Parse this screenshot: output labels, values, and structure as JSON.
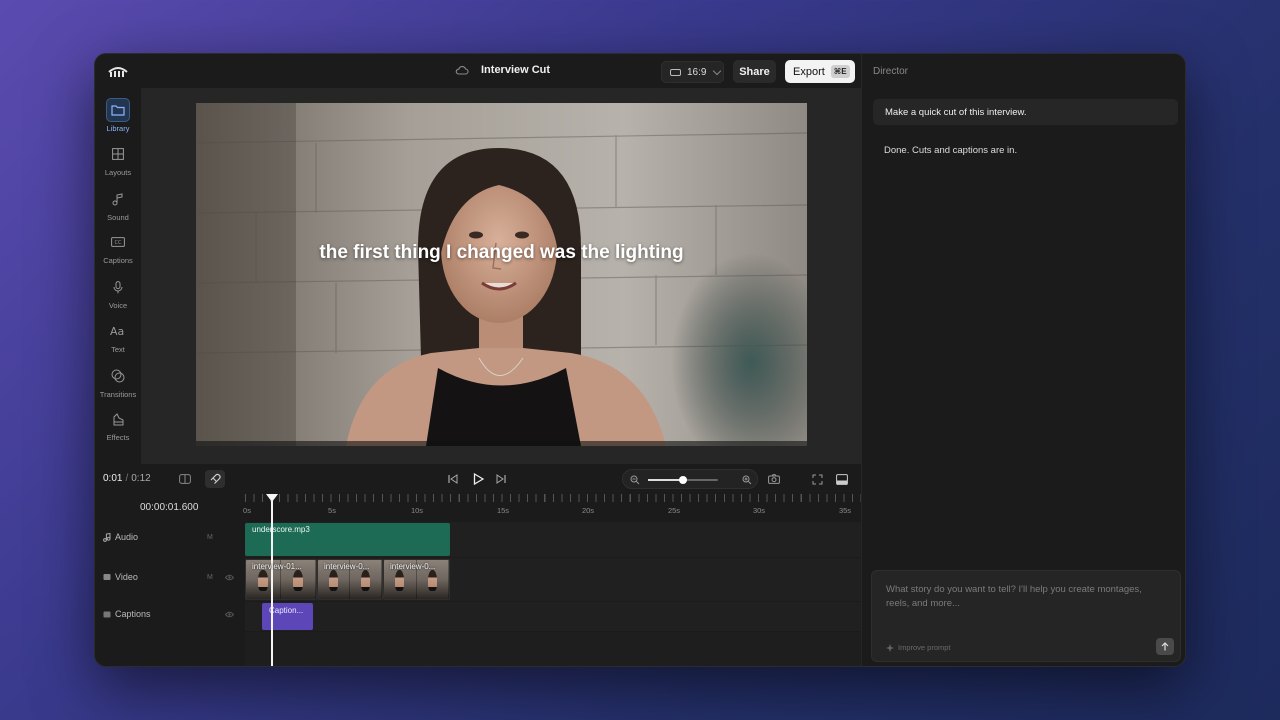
{
  "app": {
    "project_title": "Interview Cut",
    "aspect_ratio": "16:9",
    "share_label": "Share",
    "export_label": "Export",
    "export_shortcut": "⌘E"
  },
  "sidebar": {
    "items": [
      {
        "label": "Library",
        "icon": "folder-icon",
        "active": true
      },
      {
        "label": "Layouts",
        "icon": "grid-icon"
      },
      {
        "label": "Sound",
        "icon": "music-note-icon"
      },
      {
        "label": "Captions",
        "icon": "cc-icon"
      },
      {
        "label": "Voice",
        "icon": "microphone-icon"
      },
      {
        "label": "Text",
        "icon": "text-aa-icon"
      },
      {
        "label": "Transitions",
        "icon": "overlap-circles-icon"
      },
      {
        "label": "Effects",
        "icon": "effects-icon"
      }
    ]
  },
  "preview": {
    "caption": "the first thing I changed was the lighting"
  },
  "transport": {
    "current_time": "0:01",
    "total_time": "0:12",
    "zoom_level": 0.5
  },
  "timeline": {
    "timecode": "00:00:01.600",
    "ruler_labels": [
      "0s",
      "5s",
      "10s",
      "15s",
      "20s",
      "25s",
      "30s",
      "35s"
    ],
    "tracks": [
      {
        "name": "Audio",
        "icon": "music-note-icon",
        "mute": "M"
      },
      {
        "name": "Video",
        "icon": "video-icon",
        "mute": "M"
      },
      {
        "name": "Captions",
        "icon": "captions-icon"
      }
    ],
    "clips": {
      "audio": "underscore.mp3",
      "video": [
        "interview-01...",
        "interview-0...",
        "interview-0..."
      ],
      "caption": "Caption..."
    }
  },
  "director": {
    "title": "Director",
    "user_message": "Make a quick cut of this interview.",
    "assistant_message": "Done. Cuts and captions are in.",
    "prompt_placeholder": "What story do you want to tell? I'll help you create montages, reels, and more...",
    "improve_label": "Improve prompt"
  },
  "colors": {
    "accent": "#8fb4ff",
    "audio_clip": "#1e6b55",
    "caption_clip": "#5c46b8"
  }
}
